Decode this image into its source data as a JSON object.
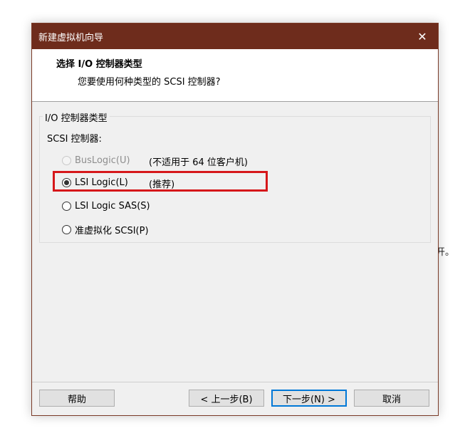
{
  "background": {
    "text": "开。"
  },
  "dialog": {
    "title": "新建虚拟机向导",
    "close_glyph": "✕",
    "header_title": "选择 I/O 控制器类型",
    "header_subtitle": "您要使用何种类型的 SCSI 控制器?",
    "group": {
      "legend": "I/O 控制器类型",
      "label": "SCSI 控制器:",
      "options": [
        {
          "label": "BusLogic(U)",
          "note": "(不适用于 64 位客户机)",
          "selected": false,
          "disabled": true
        },
        {
          "label": "LSI Logic(L)",
          "note": "(推荐)",
          "selected": true,
          "disabled": false
        },
        {
          "label": "LSI Logic SAS(S)",
          "note": "",
          "selected": false,
          "disabled": false
        },
        {
          "label": "准虚拟化 SCSI(P)",
          "note": "",
          "selected": false,
          "disabled": false
        }
      ]
    },
    "buttons": {
      "help": "帮助",
      "back": "< 上一步(B)",
      "next": "下一步(N) >",
      "cancel": "取消"
    },
    "colors": {
      "titlebar": "#6e2c1c",
      "highlight": "#d6171a",
      "accent": "#0078d7"
    }
  }
}
